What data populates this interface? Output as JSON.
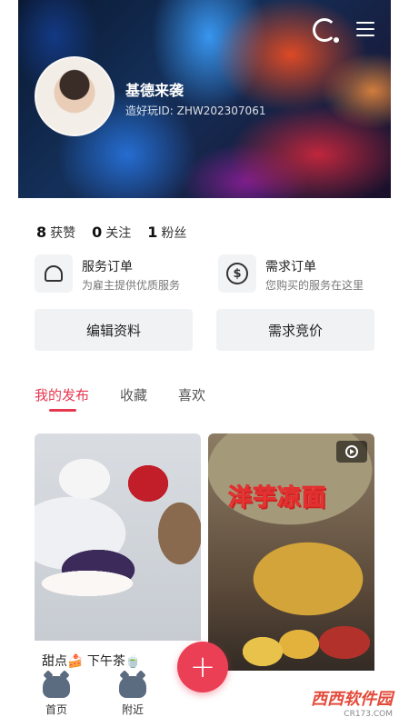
{
  "header": {
    "username": "基德来袭",
    "user_id": "造好玩ID: ZHW202307061",
    "loading_icon": "loading-icon",
    "menu_icon": "menu-icon"
  },
  "stats": [
    {
      "count": "8",
      "label": "获赞"
    },
    {
      "count": "0",
      "label": "关注"
    },
    {
      "count": "1",
      "label": "粉丝"
    }
  ],
  "orders": [
    {
      "title": "服务订单",
      "subtitle": "为雇主提供优质服务",
      "icon": "handshake-heart-icon"
    },
    {
      "title": "需求订单",
      "subtitle": "您购买的服务在这里",
      "icon": "dollar-cycle-icon"
    }
  ],
  "actions": {
    "edit_profile": "编辑资料",
    "demand_bid": "需求竞价"
  },
  "tabs": [
    {
      "label": "我的发布",
      "active": true
    },
    {
      "label": "收藏",
      "active": false
    },
    {
      "label": "喜欢",
      "active": false
    }
  ],
  "feed": [
    {
      "caption": "甜点🍰 下午茶🍵"
    },
    {
      "overlay_title": "洋芋凉面",
      "icon": "play-icon"
    }
  ],
  "bottom_nav": [
    {
      "label": "首页",
      "icon": "home-cat-icon"
    },
    {
      "label": "附近",
      "icon": "nearby-cat-icon"
    }
  ],
  "fab": {
    "label": "+"
  },
  "watermark": {
    "brand": "西西软件园",
    "domain": "CR173.COM"
  },
  "colors": {
    "accent": "#e5374f",
    "fab": "#ea3f55"
  }
}
